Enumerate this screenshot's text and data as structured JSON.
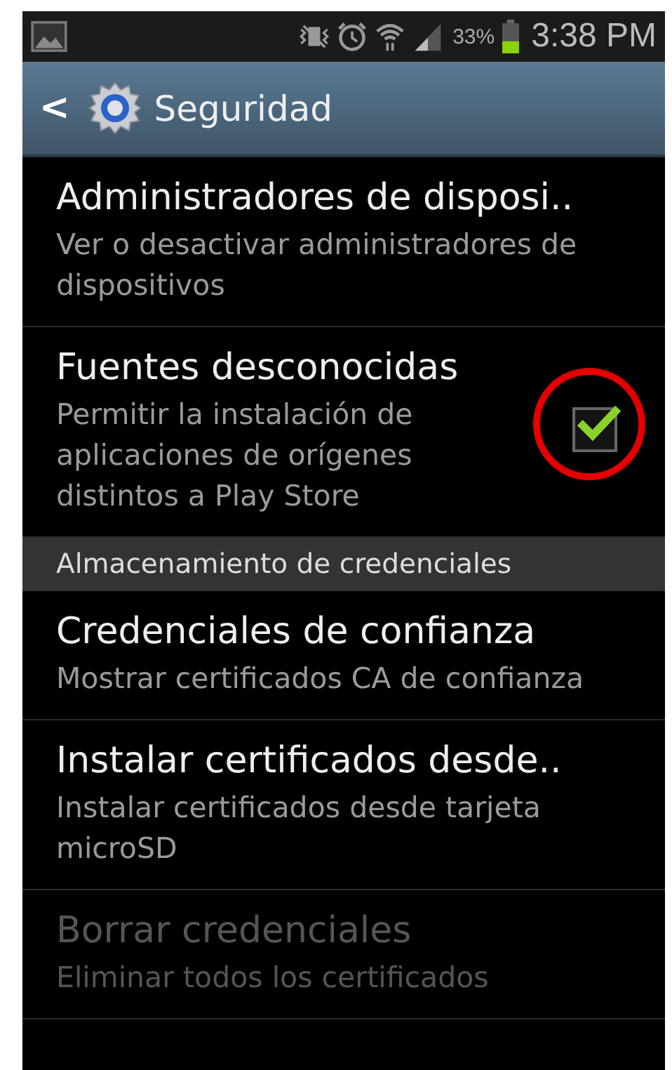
{
  "status_bar": {
    "battery": "33%",
    "time": "3:38 PM"
  },
  "action_bar": {
    "back": "<",
    "title": "Seguridad"
  },
  "items": [
    {
      "kind": "setting",
      "title": "Administradores de disposi..",
      "summary": "Ver o desactivar administradores de dispositivos",
      "disabled": false
    },
    {
      "kind": "checkbox",
      "title": "Fuentes desconocidas",
      "summary": "Permitir la instalación de aplicaciones de orígenes distintos a Play Store",
      "disabled": false,
      "checked": true
    },
    {
      "kind": "header",
      "title": "Almacenamiento de credenciales"
    },
    {
      "kind": "setting",
      "title": "Credenciales de confianza",
      "summary": "Mostrar certificados CA de confianza",
      "disabled": false
    },
    {
      "kind": "setting",
      "title": "Instalar certificados desde..",
      "summary": "Instalar certificados desde tarjeta microSD",
      "disabled": false
    },
    {
      "kind": "setting",
      "title": "Borrar credenciales",
      "summary": "Eliminar todos los certificados",
      "disabled": true
    }
  ]
}
